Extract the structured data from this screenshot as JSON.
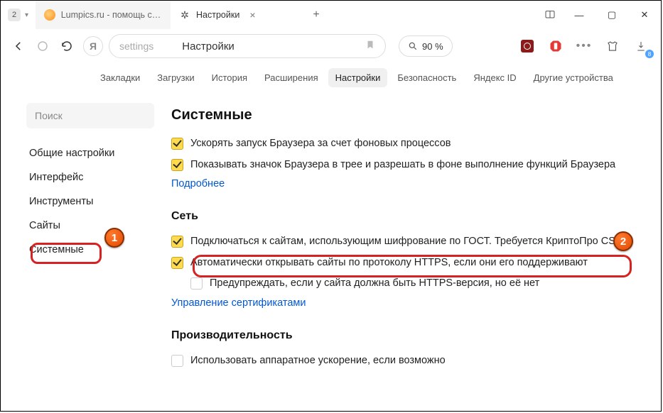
{
  "titlebar": {
    "tab_count": "2",
    "tabs": [
      {
        "label": "Lumpics.ru - помощь с ко",
        "active": false
      },
      {
        "label": "Настройки",
        "active": true
      }
    ]
  },
  "addr": {
    "protocol": "settings",
    "page": "Настройки",
    "zoom_icon": "magnifier",
    "zoom_value": "90 %",
    "download_badge": "8"
  },
  "topnav": {
    "items": [
      "Закладки",
      "Загрузки",
      "История",
      "Расширения",
      "Настройки",
      "Безопасность",
      "Яндекс ID",
      "Другие устройства"
    ],
    "active_index": 4
  },
  "sidebar": {
    "search_placeholder": "Поиск",
    "items": [
      "Общие настройки",
      "Интерфейс",
      "Инструменты",
      "Сайты",
      "Системные"
    ],
    "selected_index": 4
  },
  "markers": {
    "one": "1",
    "two": "2"
  },
  "main": {
    "section_system": "Системные",
    "sys_opts": [
      "Ускорять запуск Браузера за счет фоновых процессов",
      "Показывать значок Браузера в трее и разрешать в фоне выполнение функций Браузера"
    ],
    "more_link": "Подробнее",
    "section_net": "Сеть",
    "net_opts": [
      {
        "label": "Подключаться к сайтам, использующим шифрование по ГОСТ. Требуется КриптоПро CSP.",
        "checked": true
      },
      {
        "label": "Автоматически открывать сайты по протоколу HTTPS, если они его поддерживают",
        "checked": true
      },
      {
        "label": "Предупреждать, если у сайта должна быть HTTPS-версия, но её нет",
        "checked": false
      }
    ],
    "cert_link": "Управление сертификатами",
    "section_perf": "Производительность",
    "perf_opts": [
      {
        "label": "Использовать аппаратное ускорение, если возможно",
        "checked": false
      }
    ]
  }
}
